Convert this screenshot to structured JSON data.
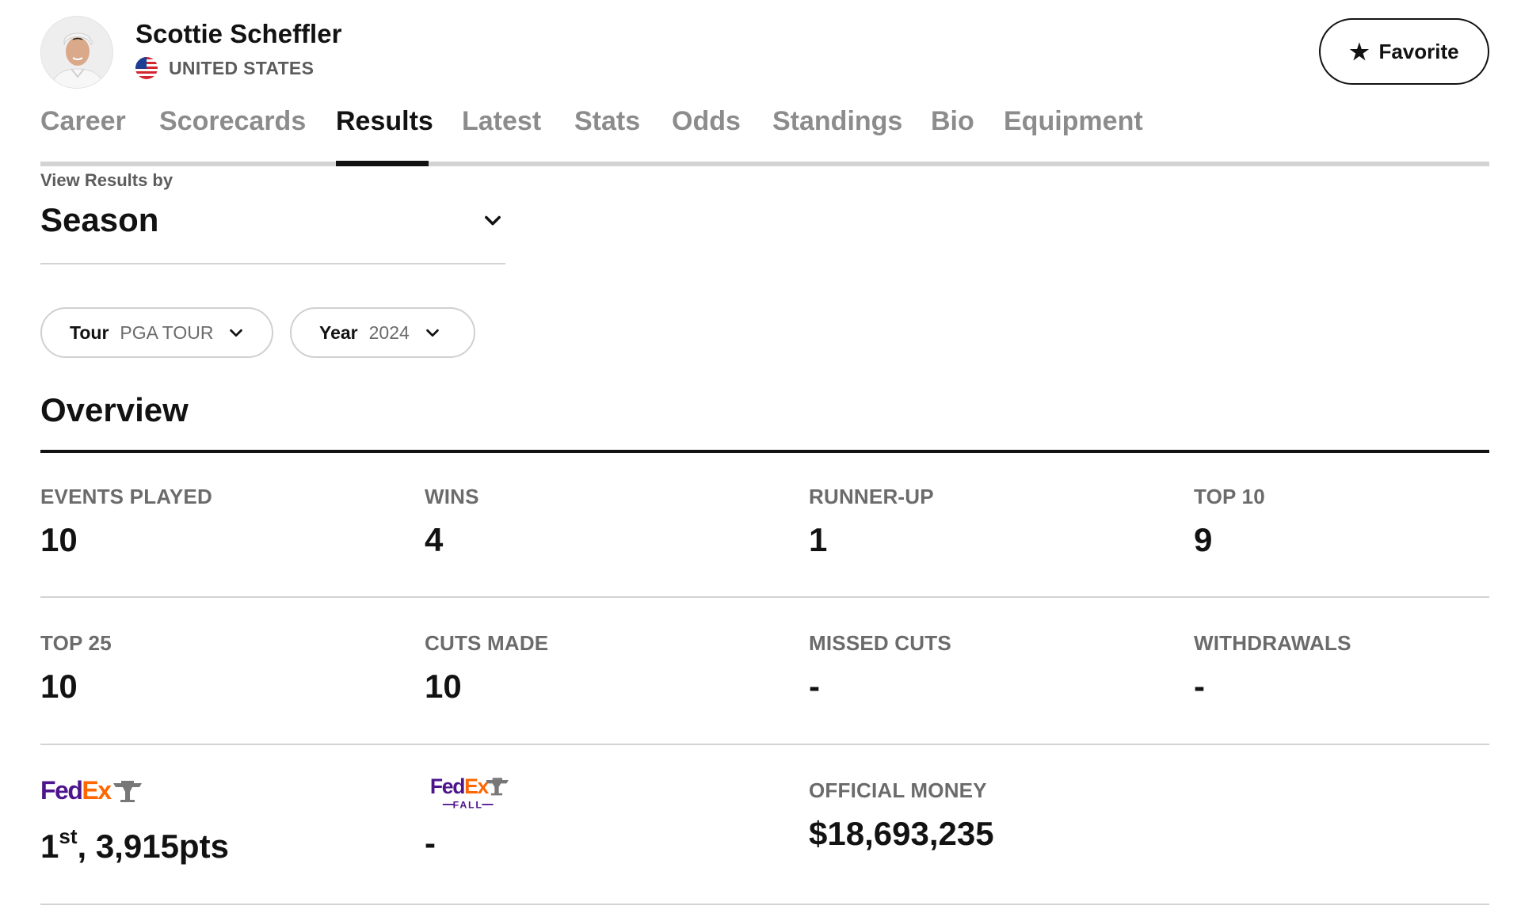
{
  "player": {
    "name": "Scottie Scheffler",
    "country": "UNITED STATES",
    "favorite_label": "Favorite"
  },
  "icons": {
    "favorite": "star-icon",
    "flag": "us-flag-icon",
    "dropdown": "chevron-down-icon"
  },
  "tabs": [
    {
      "label": "Career",
      "active": false
    },
    {
      "label": "Scorecards",
      "active": false
    },
    {
      "label": "Results",
      "active": true
    },
    {
      "label": "Latest",
      "active": false
    },
    {
      "label": "Stats",
      "active": false
    },
    {
      "label": "Odds",
      "active": false
    },
    {
      "label": "Standings",
      "active": false
    },
    {
      "label": "Bio",
      "active": false
    },
    {
      "label": "Equipment",
      "active": false
    }
  ],
  "view_by": {
    "label": "View Results by",
    "value": "Season"
  },
  "filters": {
    "tour": {
      "label": "Tour",
      "value": "PGA TOUR"
    },
    "year": {
      "label": "Year",
      "value": "2024"
    }
  },
  "overview": {
    "title": "Overview",
    "row1": [
      {
        "label": "EVENTS PLAYED",
        "value": "10"
      },
      {
        "label": "WINS",
        "value": "4"
      },
      {
        "label": "RUNNER-UP",
        "value": "1"
      },
      {
        "label": "TOP 10",
        "value": "9"
      }
    ],
    "row2": [
      {
        "label": "TOP 25",
        "value": "10"
      },
      {
        "label": "CUTS MADE",
        "value": "10"
      },
      {
        "label": "MISSED CUTS",
        "value": "-"
      },
      {
        "label": "WITHDRAWALS",
        "value": "-"
      }
    ],
    "row3": {
      "fedex_cup": {
        "logo_text": "FedEx",
        "rank": "1",
        "rank_suffix": "st",
        "points": ", 3,915pts"
      },
      "fedex_fall": {
        "logo_text": "FedEx",
        "logo_sub": "FALL",
        "value": "-"
      },
      "official_money": {
        "label": "OFFICIAL MONEY",
        "value": "$18,693,235"
      }
    }
  },
  "colors": {
    "fedex_purple": "#4d148c",
    "fedex_orange": "#ff6600",
    "text_dark": "#121212",
    "text_muted": "#6b6b6b"
  }
}
